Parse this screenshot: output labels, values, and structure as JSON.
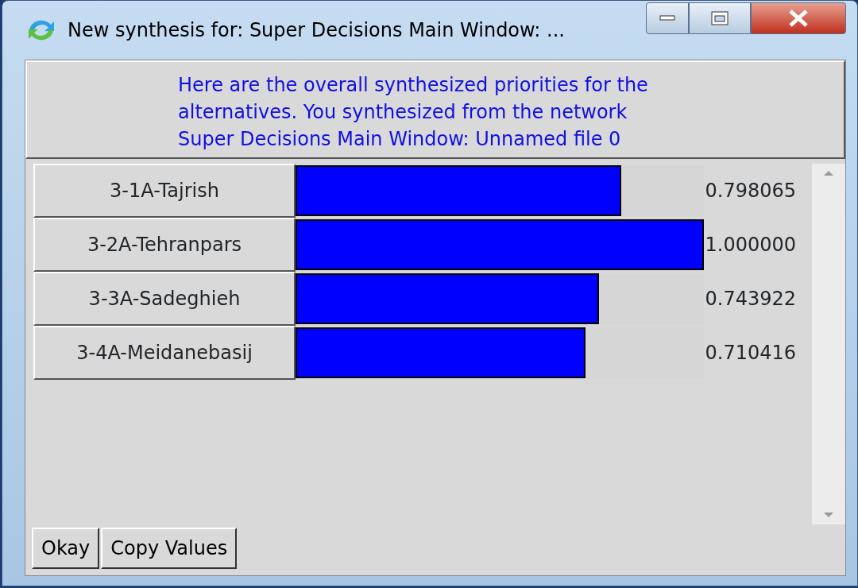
{
  "window": {
    "title": "New synthesis for: Super Decisions Main Window: ..."
  },
  "message_lines": [
    "Here are the overall synthesized priorities for the",
    "alternatives.  You synthesized from the network",
    "Super Decisions Main Window: Unnamed file 0"
  ],
  "alternatives": [
    {
      "name": "3-1A-Tajrish",
      "level": 0.798065,
      "value": "0.798065"
    },
    {
      "name": "3-2A-Tehranpars",
      "level": 1.0,
      "value": "1.000000"
    },
    {
      "name": "3-3A-Sadeghieh",
      "level": 0.743922,
      "value": "0.743922"
    },
    {
      "name": "3-4A-Meidanebasij",
      "level": 0.710416,
      "value": "0.710416"
    }
  ],
  "buttons": [
    "Okay",
    "Copy Values"
  ]
}
